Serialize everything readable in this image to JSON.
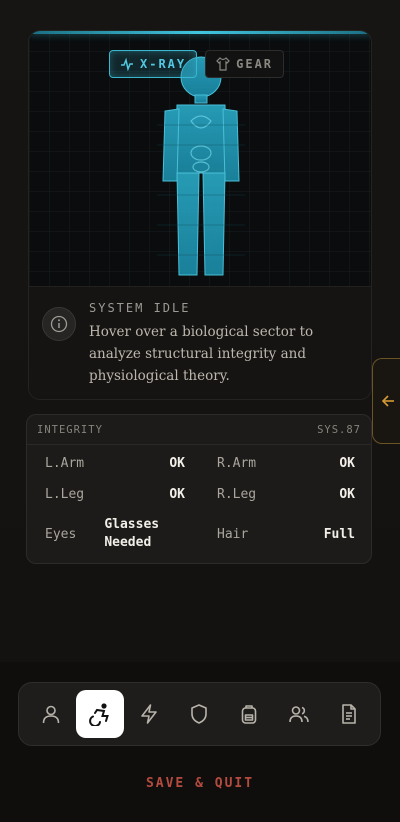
{
  "scanner": {
    "modes": [
      {
        "label": "X-RAY",
        "icon": "pulse-icon",
        "active": true
      },
      {
        "label": "GEAR",
        "icon": "shirt-icon",
        "active": false
      }
    ]
  },
  "info": {
    "icon": "info-icon",
    "title": "SYSTEM IDLE",
    "body": "Hover over a biological sector to analyze structural integrity and physiological theory."
  },
  "side_tab": {
    "icon": "arrow-left-icon"
  },
  "integrity": {
    "title": "INTEGRITY",
    "code": "SYS.87",
    "rows": [
      {
        "label": "L.Arm",
        "value": "OK"
      },
      {
        "label": "R.Arm",
        "value": "OK"
      },
      {
        "label": "L.Leg",
        "value": "OK"
      },
      {
        "label": "R.Leg",
        "value": "OK"
      },
      {
        "label": "Eyes",
        "value": "Glasses\nNeeded"
      },
      {
        "label": "Hair",
        "value": "Full"
      }
    ]
  },
  "nav": {
    "items": [
      {
        "icon": "user-icon",
        "active": false
      },
      {
        "icon": "accessibility-icon",
        "active": true
      },
      {
        "icon": "lightning-icon",
        "active": false
      },
      {
        "icon": "shield-icon",
        "active": false
      },
      {
        "icon": "backpack-icon",
        "active": false
      },
      {
        "icon": "users-icon",
        "active": false
      },
      {
        "icon": "document-icon",
        "active": false
      }
    ]
  },
  "footer": {
    "save_label": "SAVE & QUIT"
  },
  "colors": {
    "accent_cyan": "#41c6e0",
    "accent_gold": "#c99a3b",
    "danger": "#b44b3f"
  }
}
